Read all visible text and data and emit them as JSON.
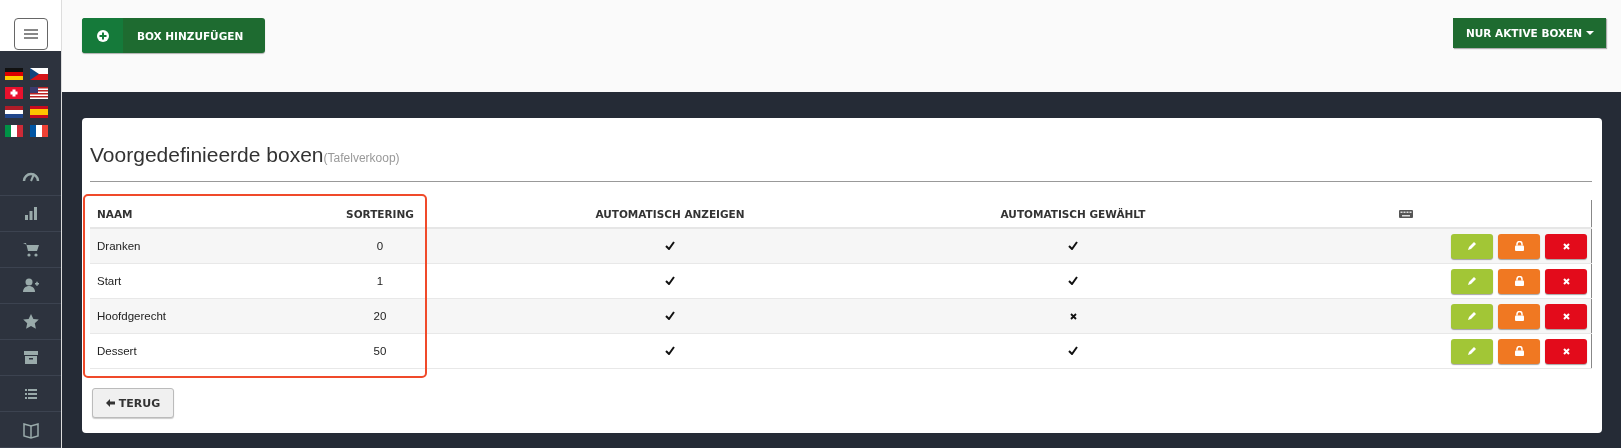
{
  "top_bar": {
    "add_button": "BOX HINZUFÜGEN",
    "filter_dropdown": "NUR AKTIVE BOXEN"
  },
  "card": {
    "title": "Voorgedefinieerde boxen",
    "subtitle": "(Tafelverkoop)",
    "table": {
      "columns": [
        "NAAM",
        "SORTERING",
        "AUTOMATISCH ANZEIGEN",
        "AUTOMATISCH GEWÄHLT"
      ],
      "rows": [
        {
          "name": "Dranken",
          "sort": "0",
          "auto_show": true,
          "auto_selected": true
        },
        {
          "name": "Start",
          "sort": "1",
          "auto_show": true,
          "auto_selected": true
        },
        {
          "name": "Hoofdgerecht",
          "sort": "20",
          "auto_show": true,
          "auto_selected": false
        },
        {
          "name": "Dessert",
          "sort": "50",
          "auto_show": true,
          "auto_selected": true
        }
      ]
    },
    "back_button": "TERUG"
  }
}
